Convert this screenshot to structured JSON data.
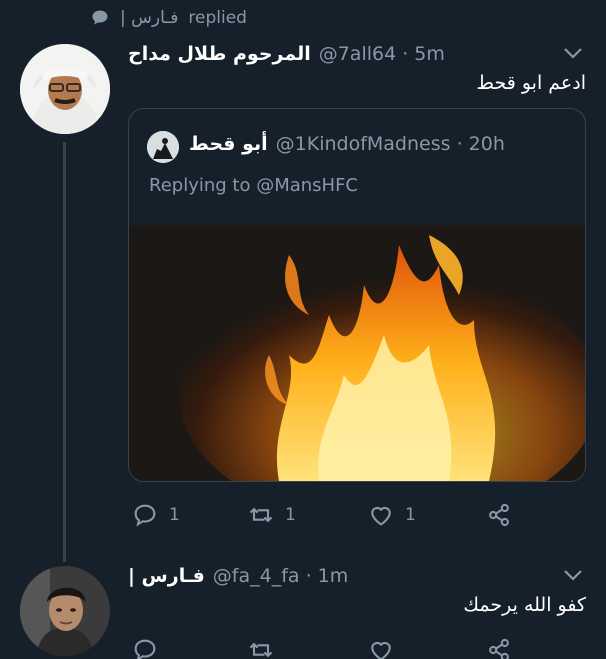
{
  "context": {
    "icon": "speech-bubble-icon",
    "name": "فـارس |",
    "action": "replied"
  },
  "tweet1": {
    "display_name": "المرحوم طلال مداح",
    "handle_time": "@7all64 · 5m",
    "text": "ادعم ابو قحط"
  },
  "quoted": {
    "display_name": "أبو قحط",
    "handle_time": "@1KindofMadness · 20h",
    "replying_to": "Replying to @MansHFC",
    "image": "fire-flames-photo"
  },
  "actions1": {
    "reply_count": "1",
    "retweet_count": "1",
    "like_count": "1"
  },
  "tweet2": {
    "display_name": "فـارس |",
    "handle_time": "@fa_4_fa · 1m",
    "text": "كفو الله يرحمك"
  },
  "colors": {
    "background": "#15202b",
    "muted": "#8899a6",
    "border": "#38444d"
  }
}
